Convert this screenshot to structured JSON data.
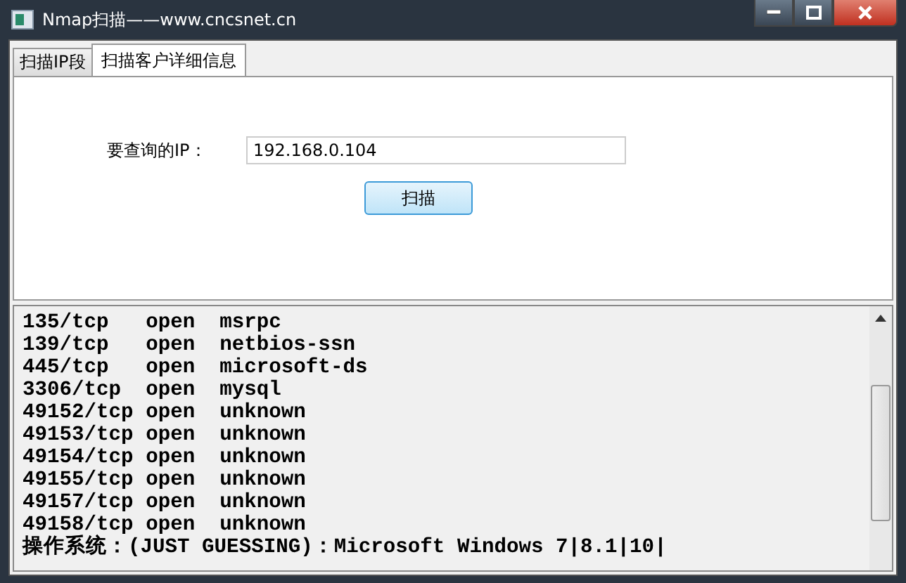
{
  "window": {
    "title": "Nmap扫描——www.cncsnet.cn"
  },
  "tabs": [
    {
      "label": "扫描IP段",
      "selected": false
    },
    {
      "label": "扫描客户详细信息",
      "selected": true
    }
  ],
  "form": {
    "ip_label": "要查询的IP：",
    "ip_value": "192.168.0.104",
    "scan_button": "扫描"
  },
  "output": {
    "lines": [
      "135/tcp   open  msrpc",
      "139/tcp   open  netbios-ssn",
      "445/tcp   open  microsoft-ds",
      "3306/tcp  open  mysql",
      "49152/tcp open  unknown",
      "49153/tcp open  unknown",
      "49154/tcp open  unknown",
      "49155/tcp open  unknown",
      "49157/tcp open  unknown",
      "49158/tcp open  unknown",
      "操作系统：(JUST GUESSING)：Microsoft Windows 7|8.1|10|"
    ]
  }
}
